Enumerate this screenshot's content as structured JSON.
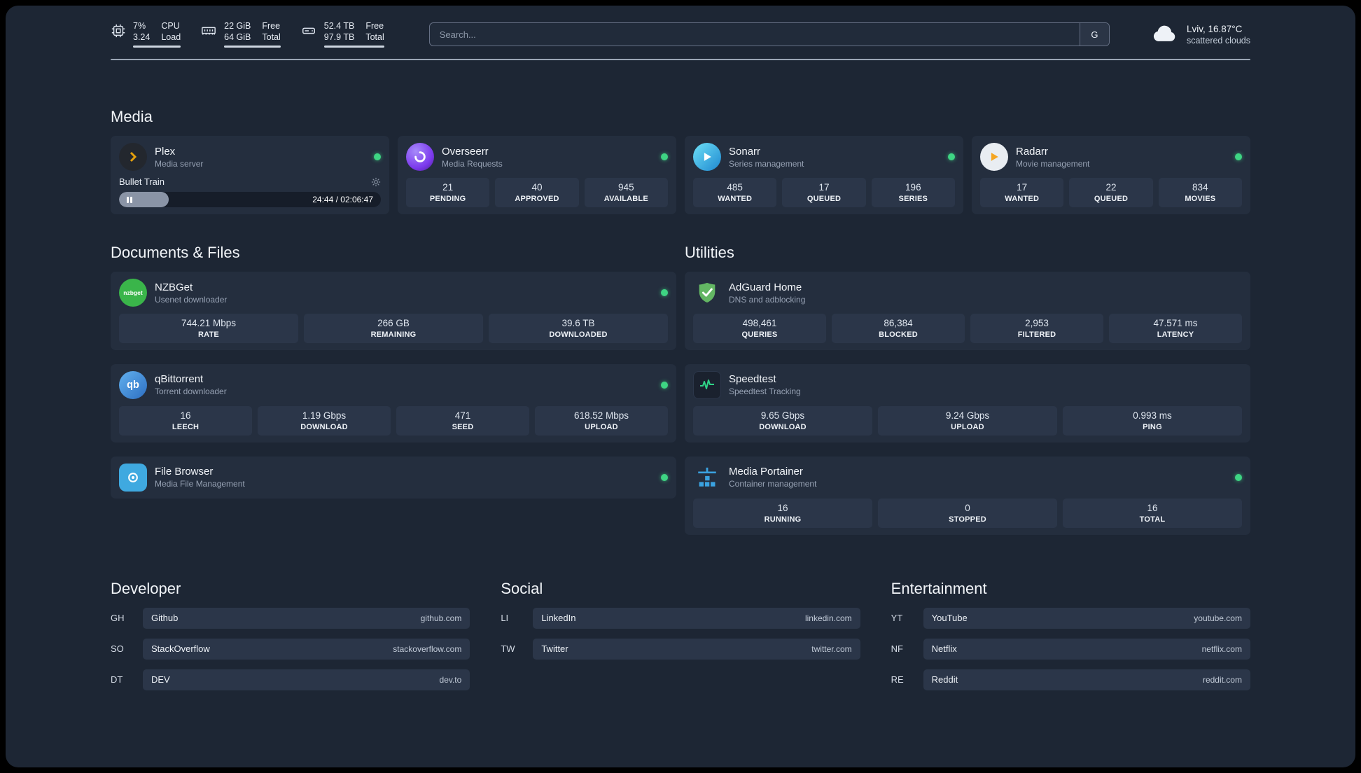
{
  "colors": {
    "background": "#1d2634",
    "card": "#242e3e",
    "stat_box": "#2b3649",
    "status_green": "#3ed583",
    "plex_gold": "#e5a00d",
    "adguard_green": "#63b663",
    "portainer_blue": "#3aa2e0"
  },
  "topbar": {
    "cpu": {
      "value1": "7%",
      "value2": "3.24",
      "label1": "CPU",
      "label2": "Load"
    },
    "ram": {
      "value1": "22 GiB",
      "value2": "64 GiB",
      "label1": "Free",
      "label2": "Total"
    },
    "disk": {
      "value1": "52.4 TB",
      "value2": "97.9 TB",
      "label1": "Free",
      "label2": "Total"
    },
    "search": {
      "placeholder": "Search...",
      "button": "G"
    },
    "weather": {
      "location": "Lviv, 16.87°C",
      "condition": "scattered clouds"
    }
  },
  "media": {
    "title": "Media",
    "plex": {
      "name": "Plex",
      "subtitle": "Media server",
      "now_playing": "Bullet Train",
      "time": "24:44 / 02:06:47",
      "progress_percent": 19
    },
    "overseerr": {
      "name": "Overseerr",
      "subtitle": "Media Requests",
      "stats": [
        {
          "value": "21",
          "label": "PENDING"
        },
        {
          "value": "40",
          "label": "APPROVED"
        },
        {
          "value": "945",
          "label": "AVAILABLE"
        }
      ]
    },
    "sonarr": {
      "name": "Sonarr",
      "subtitle": "Series management",
      "stats": [
        {
          "value": "485",
          "label": "WANTED"
        },
        {
          "value": "17",
          "label": "QUEUED"
        },
        {
          "value": "196",
          "label": "SERIES"
        }
      ]
    },
    "radarr": {
      "name": "Radarr",
      "subtitle": "Movie management",
      "stats": [
        {
          "value": "17",
          "label": "WANTED"
        },
        {
          "value": "22",
          "label": "QUEUED"
        },
        {
          "value": "834",
          "label": "MOVIES"
        }
      ]
    }
  },
  "documents": {
    "title": "Documents & Files",
    "nzbget": {
      "name": "NZBGet",
      "subtitle": "Usenet downloader",
      "icon_text": "nzbget",
      "stats": [
        {
          "value": "744.21 Mbps",
          "label": "RATE"
        },
        {
          "value": "266 GB",
          "label": "REMAINING"
        },
        {
          "value": "39.6 TB",
          "label": "DOWNLOADED"
        }
      ]
    },
    "qbittorrent": {
      "name": "qBittorrent",
      "subtitle": "Torrent downloader",
      "icon_text": "qb",
      "stats": [
        {
          "value": "16",
          "label": "LEECH"
        },
        {
          "value": "1.19 Gbps",
          "label": "DOWNLOAD"
        },
        {
          "value": "471",
          "label": "SEED"
        },
        {
          "value": "618.52 Mbps",
          "label": "UPLOAD"
        }
      ]
    },
    "filebrowser": {
      "name": "File Browser",
      "subtitle": "Media File Management"
    }
  },
  "utilities": {
    "title": "Utilities",
    "adguard": {
      "name": "AdGuard Home",
      "subtitle": "DNS and adblocking",
      "stats": [
        {
          "value": "498,461",
          "label": "QUERIES"
        },
        {
          "value": "86,384",
          "label": "BLOCKED"
        },
        {
          "value": "2,953",
          "label": "FILTERED"
        },
        {
          "value": "47.571 ms",
          "label": "LATENCY"
        }
      ]
    },
    "speedtest": {
      "name": "Speedtest",
      "subtitle": "Speedtest Tracking",
      "stats": [
        {
          "value": "9.65 Gbps",
          "label": "DOWNLOAD"
        },
        {
          "value": "9.24 Gbps",
          "label": "UPLOAD"
        },
        {
          "value": "0.993 ms",
          "label": "PING"
        }
      ]
    },
    "portainer": {
      "name": "Media Portainer",
      "subtitle": "Container management",
      "stats": [
        {
          "value": "16",
          "label": "RUNNING"
        },
        {
          "value": "0",
          "label": "STOPPED"
        },
        {
          "value": "16",
          "label": "TOTAL"
        }
      ]
    }
  },
  "bookmarks": {
    "developer": {
      "title": "Developer",
      "items": [
        {
          "abbr": "GH",
          "name": "Github",
          "url": "github.com"
        },
        {
          "abbr": "SO",
          "name": "StackOverflow",
          "url": "stackoverflow.com"
        },
        {
          "abbr": "DT",
          "name": "DEV",
          "url": "dev.to"
        }
      ]
    },
    "social": {
      "title": "Social",
      "items": [
        {
          "abbr": "LI",
          "name": "LinkedIn",
          "url": "linkedin.com"
        },
        {
          "abbr": "TW",
          "name": "Twitter",
          "url": "twitter.com"
        }
      ]
    },
    "entertainment": {
      "title": "Entertainment",
      "items": [
        {
          "abbr": "YT",
          "name": "YouTube",
          "url": "youtube.com"
        },
        {
          "abbr": "NF",
          "name": "Netflix",
          "url": "netflix.com"
        },
        {
          "abbr": "RE",
          "name": "Reddit",
          "url": "reddit.com"
        }
      ]
    }
  }
}
